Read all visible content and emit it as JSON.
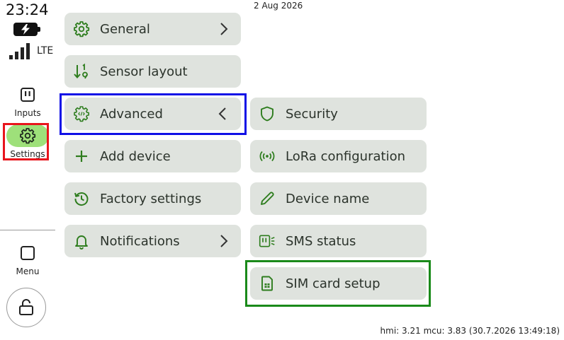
{
  "status": {
    "time": "23:24",
    "network": "LTE",
    "date": "2 Aug 2026"
  },
  "nav": {
    "inputs_label": "Inputs",
    "settings_label": "Settings",
    "menu_label": "Menu"
  },
  "menu": {
    "general": "General",
    "sensor_layout": "Sensor layout",
    "advanced": "Advanced",
    "add_device": "Add device",
    "factory_settings": "Factory settings",
    "notifications": "Notifications"
  },
  "advanced_submenu": {
    "security": "Security",
    "lora_configuration": "LoRa configuration",
    "device_name": "Device name",
    "sms_status": "SMS status",
    "sim_card_setup": "SIM card setup"
  },
  "footer": {
    "version": "hmi: 3.21 mcu: 3.83 (30.7.2026 13:49:18)"
  },
  "colors": {
    "accent_green": "#2e7d1e",
    "button_bg": "#dfe3de",
    "settings_pill": "#9ee07a",
    "highlight_red": "#e8141c",
    "highlight_blue": "#1010e6",
    "highlight_green": "#1a8a1a"
  }
}
